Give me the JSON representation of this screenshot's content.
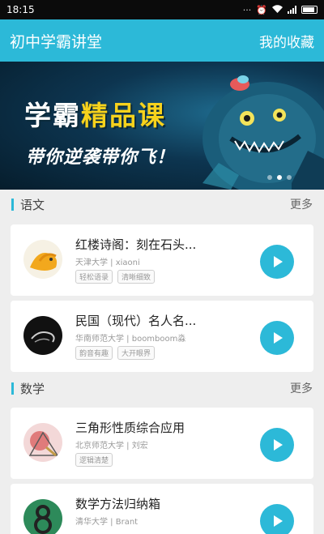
{
  "status_bar": {
    "time": "18:15",
    "icons": [
      "alarm-icon",
      "wifi-icon",
      "signal-icon",
      "battery-icon"
    ],
    "extra": "···"
  },
  "app_bar": {
    "title": "初中学霸讲堂",
    "favorites_label": "我的收藏",
    "color": "#2cb9d8"
  },
  "banner": {
    "title_white": "学霸",
    "title_yellow": "精品课",
    "subtitle": "带你逆袭带你飞！",
    "slides": 3,
    "active_slide": 1
  },
  "sections": [
    {
      "title": "语文",
      "more_label": "更多",
      "courses": [
        {
          "title": "红楼诗阁：刻在石头...",
          "meta": "天津大学 | xiaoni",
          "tags": [
            "轻松语录",
            "清晰细致"
          ],
          "thumb_icon": "bird-thumbnail"
        },
        {
          "title": "民国（现代）名人名...",
          "meta": "华南师范大学 | boomboom淼",
          "tags": [
            "韵音有趣",
            "大开眼界"
          ],
          "thumb_icon": "dark-thumbnail"
        }
      ]
    },
    {
      "title": "数学",
      "more_label": "更多",
      "courses": [
        {
          "title": "三角形性质综合应用",
          "meta": "北京师范大学 | 刘宏",
          "tags": [
            "逻辑清楚"
          ],
          "thumb_icon": "triangle-thumbnail"
        },
        {
          "title": "数学方法归纳箱",
          "meta": "清华大学 | Brant",
          "tags": [],
          "thumb_icon": "number-eight-thumbnail"
        }
      ]
    }
  ]
}
